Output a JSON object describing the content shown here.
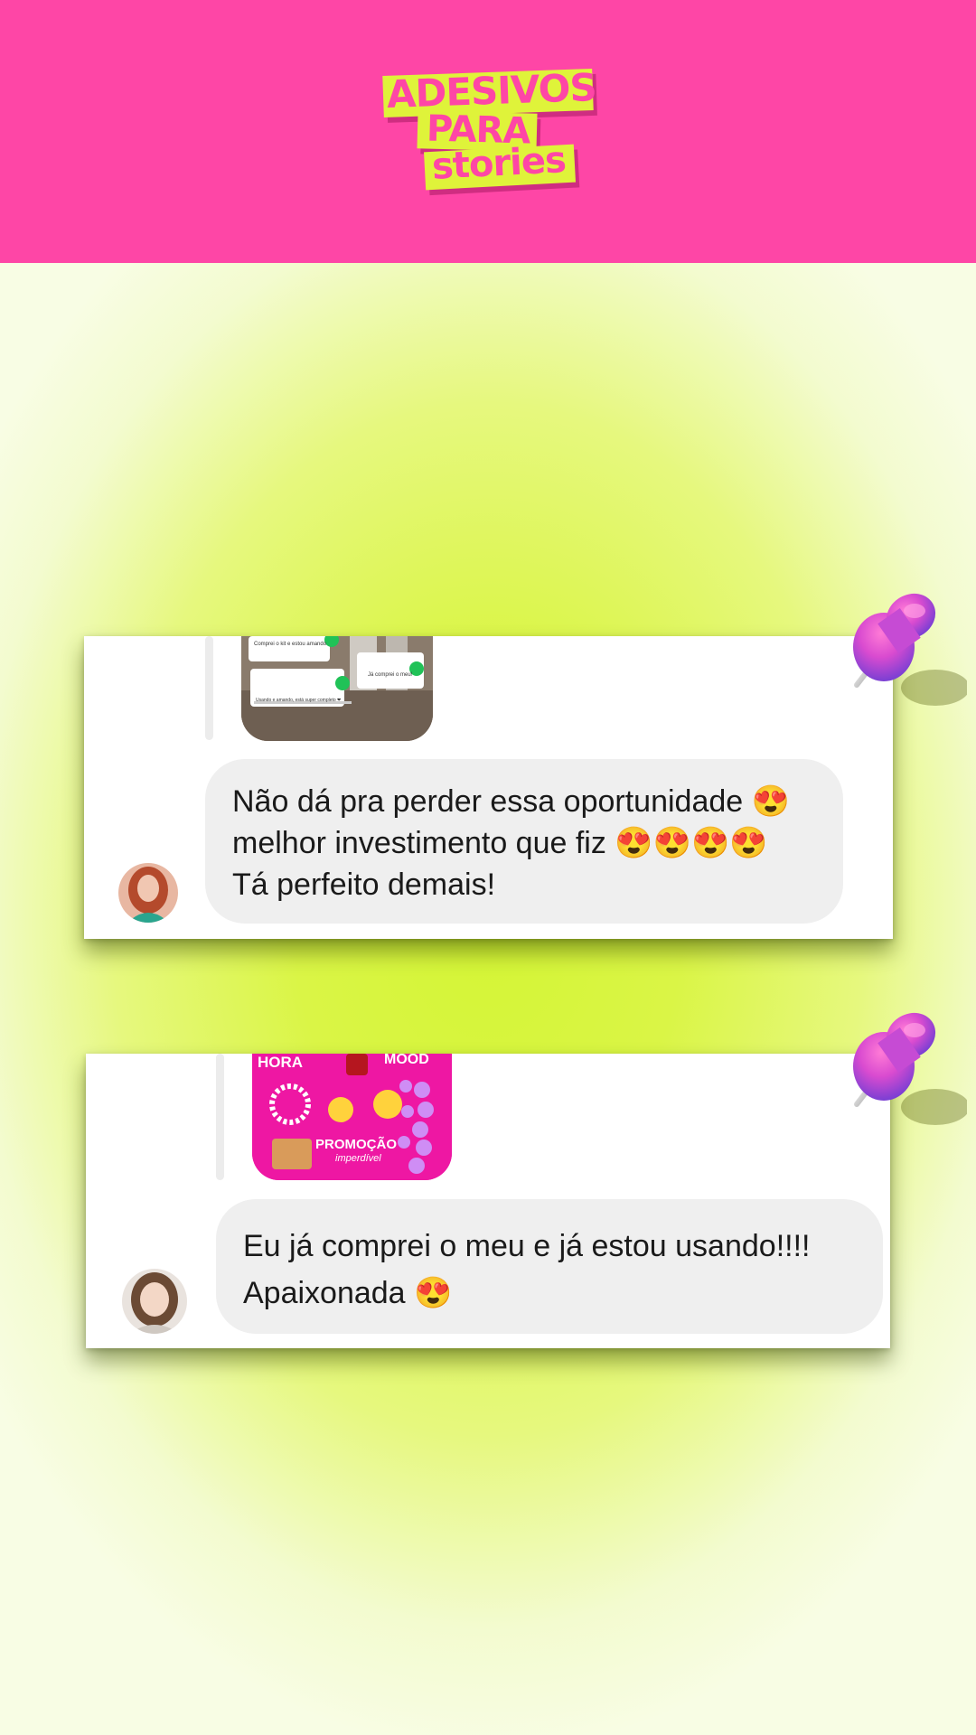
{
  "brand": {
    "logo_line1": "ADESIVOS",
    "logo_line2": "PARA",
    "logo_line3": "stories",
    "header_color": "#fe46a6",
    "accent_color": "#dff33a"
  },
  "comments": [
    {
      "preview_texts": [
        "Comprei o kit e estou amando",
        "Já comprei o meu!",
        "Usando e amando, está super completo ❤"
      ],
      "lines": [
        "Não dá pra perder essa oportunidade 😍",
        "melhor investimento que fiz 😍😍😍😍",
        "Tá perfeito demais!"
      ]
    },
    {
      "preview_texts": [
        "HORA",
        "MOOD",
        "PROMOÇÃO",
        "imperdível"
      ],
      "lines": [
        "Eu já comprei o meu e já estou usando!!!!",
        "Apaixonada 😍"
      ]
    }
  ]
}
